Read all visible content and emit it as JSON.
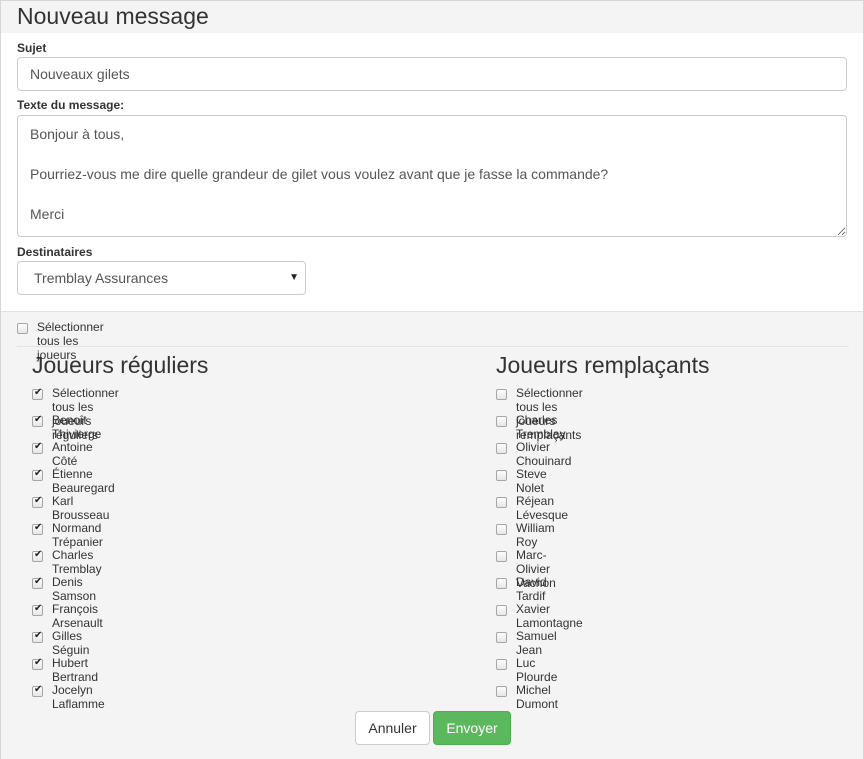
{
  "header": {
    "title": "Nouveau message"
  },
  "form": {
    "subject_label": "Sujet",
    "subject_value": "Nouveaux gilets",
    "body_label": "Texte du message:",
    "body_value": "Bonjour à tous,\n\nPourriez-vous me dire quelle grandeur de gilet vous voulez avant que je fasse la commande?\n\nMerci",
    "recipients_label": "Destinataires",
    "recipients_selected": "Tremblay Assurances"
  },
  "select_all": {
    "label": "Sélectionner tous les joueurs",
    "checked": false
  },
  "regular": {
    "title": "Joueurs réguliers",
    "select_all_label": "Sélectionner tous les joueurs réguliers",
    "select_all_checked": true,
    "players": [
      {
        "name": "Benoît Thivierge",
        "checked": true
      },
      {
        "name": "Antoine Côté",
        "checked": true
      },
      {
        "name": "Étienne Beauregard",
        "checked": true
      },
      {
        "name": "Karl Brousseau",
        "checked": true
      },
      {
        "name": "Normand Trépanier",
        "checked": true
      },
      {
        "name": "Charles Tremblay",
        "checked": true
      },
      {
        "name": "Denis Samson",
        "checked": true
      },
      {
        "name": "François Arsenault",
        "checked": true
      },
      {
        "name": "Gilles Séguin",
        "checked": true
      },
      {
        "name": "Hubert Bertrand",
        "checked": true
      },
      {
        "name": "Jocelyn Laflamme",
        "checked": true
      }
    ]
  },
  "substitute": {
    "title": "Joueurs remplaçants",
    "select_all_label": "Sélectionner tous les joueurs remplaçants",
    "select_all_checked": false,
    "players": [
      {
        "name": "Charles Tremblay",
        "checked": false
      },
      {
        "name": "Olivier Chouinard",
        "checked": false
      },
      {
        "name": "Steve Nolet",
        "checked": false
      },
      {
        "name": "Réjean Lévesque",
        "checked": false
      },
      {
        "name": "William Roy",
        "checked": false
      },
      {
        "name": "Marc-Olivier Vachon",
        "checked": false
      },
      {
        "name": "David Tardif",
        "checked": false
      },
      {
        "name": "Xavier Lamontagne",
        "checked": false
      },
      {
        "name": "Samuel Jean",
        "checked": false
      },
      {
        "name": "Luc Plourde",
        "checked": false
      },
      {
        "name": "Michel Dumont",
        "checked": false
      }
    ]
  },
  "actions": {
    "cancel_label": "Annuler",
    "send_label": "Envoyer"
  },
  "colors": {
    "primary_button": "#5cb85c",
    "panel_bg": "#f4f4f4"
  }
}
